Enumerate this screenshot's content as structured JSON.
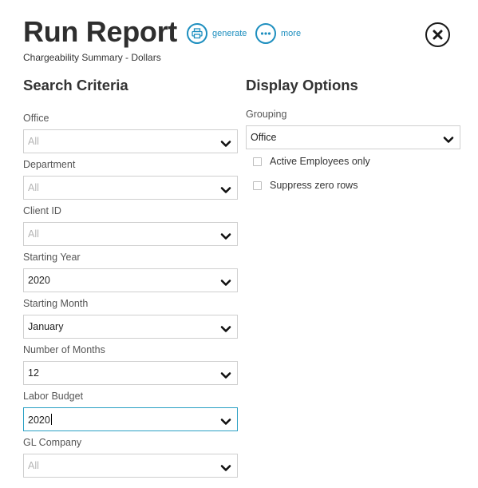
{
  "header": {
    "title": "Run Report",
    "subtitle": "Chargeability Summary - Dollars",
    "generate_label": "generate",
    "more_label": "more"
  },
  "search_criteria": {
    "heading": "Search Criteria",
    "fields": [
      {
        "label": "Office",
        "value": "All",
        "placeholder": true
      },
      {
        "label": "Department",
        "value": "All",
        "placeholder": true
      },
      {
        "label": "Client ID",
        "value": "All",
        "placeholder": true
      },
      {
        "label": "Starting Year",
        "value": "2020",
        "placeholder": false
      },
      {
        "label": "Starting Month",
        "value": "January",
        "placeholder": false
      },
      {
        "label": "Number of Months",
        "value": "12",
        "placeholder": false
      },
      {
        "label": "Labor Budget",
        "value": "2020",
        "placeholder": false
      },
      {
        "label": "GL Company",
        "value": "All",
        "placeholder": true
      }
    ]
  },
  "display_options": {
    "heading": "Display Options",
    "grouping_label": "Grouping",
    "grouping_value": "Office",
    "checkboxes": [
      {
        "label": "Active Employees only",
        "checked": false
      },
      {
        "label": "Suppress zero rows",
        "checked": false
      }
    ]
  },
  "colors": {
    "accent": "#1e8fbf",
    "focus_border": "#2aa0c4"
  }
}
